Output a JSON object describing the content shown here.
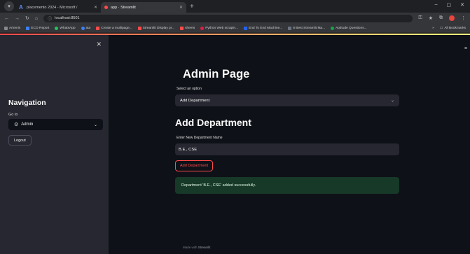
{
  "browser": {
    "tabs": [
      {
        "title": "placemento 2024 - Microsoft /"
      },
      {
        "title": "app · Streamlit"
      }
    ],
    "address": "localhost:8501",
    "bookmarks": [
      {
        "label": "Artemis",
        "color": "#888888"
      },
      {
        "label": "ECO Report",
        "color": "#3b82f6"
      },
      {
        "label": "WhatsApp",
        "color": "#22c55e"
      },
      {
        "label": "ata",
        "color": "#3b82f6"
      },
      {
        "label": "Create a multipage...",
        "color": "#ff4b4b"
      },
      {
        "label": "Streamlit Display pr...",
        "color": "#ff4b4b"
      },
      {
        "label": "sheets",
        "color": "#ff4b4b"
      },
      {
        "label": "Python Web scrapin...",
        "color": "#e11d48"
      },
      {
        "label": "End To End Machine...",
        "color": "#2563eb"
      },
      {
        "label": "8 Best Streamlit Ma...",
        "color": "#6b7280"
      },
      {
        "label": "Aptitude Questions...",
        "color": "#16a34a"
      }
    ],
    "bookmarks_all": "All Bookmarks"
  },
  "sidebar": {
    "nav_title": "Navigation",
    "goto_label": "Go to",
    "selected_page": "Admin",
    "logout_label": "Logout"
  },
  "main": {
    "title": "Admin Page",
    "select_label": "Select an option",
    "selected_option": "Add Department",
    "section_title": "Add Department",
    "input_label": "Enter New Department Name",
    "input_value": "B.E., CSE",
    "add_button_label": "Add Department",
    "success_message": "Department 'B.E., CSE' added successfully.",
    "footer_prefix": "Made with",
    "footer_brand": "Streamlit"
  },
  "colors": {
    "accent": "#ff4b4b",
    "success_bg": "#173928",
    "sidebar_bg": "#262730",
    "app_bg": "#0e1117"
  }
}
